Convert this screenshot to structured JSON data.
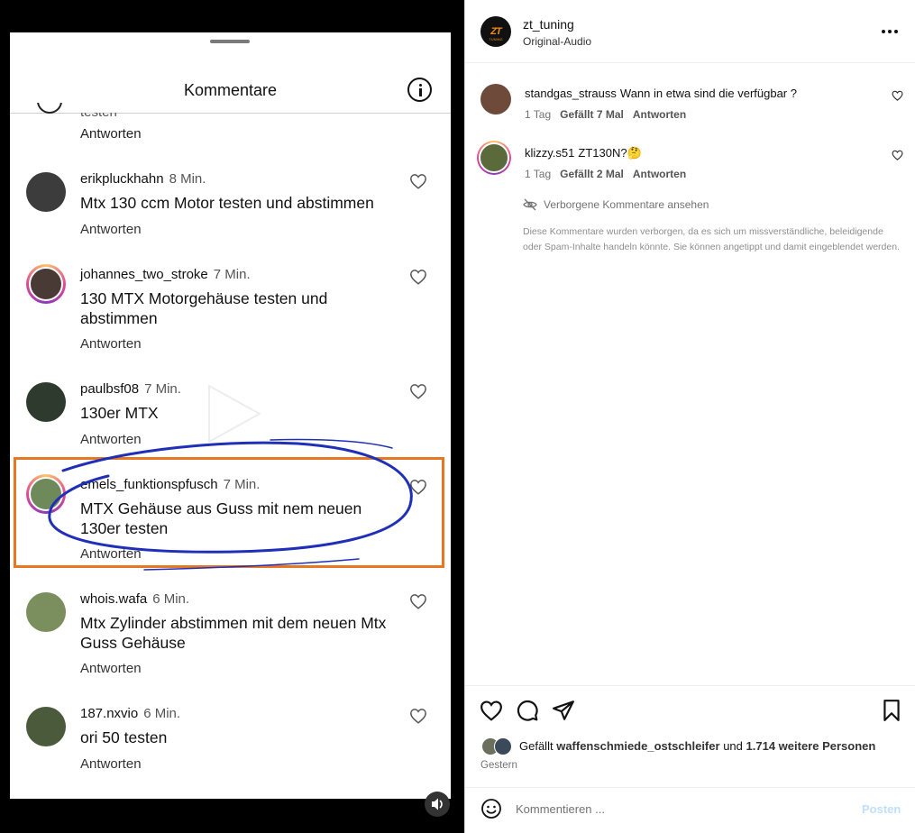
{
  "overlay": {
    "title": "Kommentare",
    "partial_text": "testen",
    "reply_label": "Antworten",
    "comments": [
      {
        "user": "erikpluckhahn",
        "time": "8 Min.",
        "text": "Mtx 130 ccm Motor testen und abstimmen",
        "avatar_color": "#3c3c3c"
      },
      {
        "user": "johannes_two_stroke",
        "time": "7 Min.",
        "text": "130 MTX Motorgehäuse testen und abstimmen",
        "avatar_color": "#4a3a36"
      },
      {
        "user": "paulbsf08",
        "time": "7 Min.",
        "text": "130er MTX",
        "avatar_color": "#2f3a2e"
      },
      {
        "user": "emels_funktionspfusch",
        "time": "7 Min.",
        "text": "MTX Gehäuse aus Guss mit nem neuen 130er testen",
        "avatar_color": "#6f8a5a"
      },
      {
        "user": "whois.wafa",
        "time": "6 Min.",
        "text": "Mtx Zylinder abstimmen mit dem neuen Mtx Guss Gehäuse",
        "avatar_color": "#7a8e5e"
      },
      {
        "user": "187.nxvio",
        "time": "6 Min.",
        "text": "ori 50 testen",
        "avatar_color": "#4a5a3a"
      }
    ]
  },
  "post": {
    "username": "zt_tuning",
    "audio": "Original-Audio",
    "logo_text": "ZT",
    "logo_sub": "TUNING",
    "comments": [
      {
        "user": "standgas_strauss",
        "text": "Wann in etwa sind die verfügbar ?",
        "age": "1 Tag",
        "likes": "Gefällt 7 Mal",
        "reply": "Antworten",
        "avatar_color": "#6e4a3a"
      },
      {
        "user": "klizzy.s51",
        "text": "ZT130N?🤔",
        "age": "1 Tag",
        "likes": "Gefällt 2 Mal",
        "reply": "Antworten",
        "avatar_color": "#5a6a3a"
      }
    ],
    "hidden_link": "Verborgene Kommentare ansehen",
    "hidden_note": "Diese Kommentare wurden verborgen, da es sich um missverständliche, beleidigende oder Spam-Inhalte handeln könnte. Sie können angetippt und damit eingeblendet werden.",
    "likes_prefix": "Gefällt",
    "likes_user": "waffenschmiede_ostschleifer",
    "likes_middle": "und",
    "likes_count": "1.714 weitere Personen",
    "time": "Gestern",
    "comment_placeholder": "Kommentieren ...",
    "post_button": "Posten"
  },
  "colors": {
    "highlight_box": "#e87722",
    "annotation_ink": "#1f2fb8",
    "post_button_disabled": "#c0dffd"
  }
}
